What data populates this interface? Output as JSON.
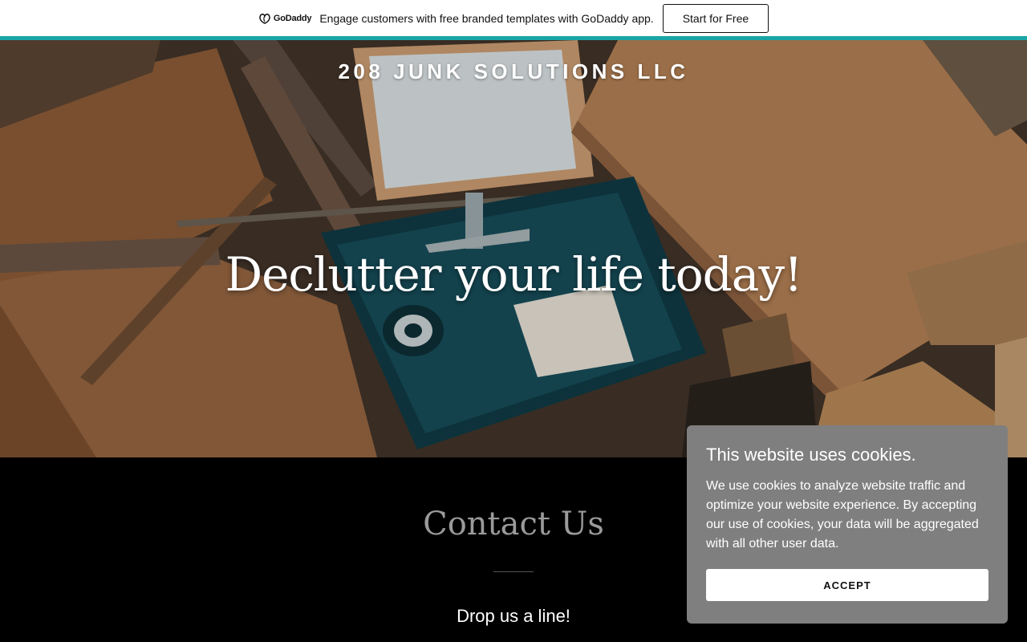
{
  "promo": {
    "logo_text": "GoDaddy",
    "logo_icon": "godaddy-logo-icon",
    "message": "Engage customers with free branded templates with GoDaddy app.",
    "cta_label": "Start for Free",
    "accent_color": "#1aa5a5"
  },
  "hero": {
    "site_title": "208 JUNK SOLUTIONS LLC",
    "headline": "Declutter your life today!"
  },
  "contact": {
    "title": "Contact Us",
    "subtitle": "Drop us a line!"
  },
  "cookie_banner": {
    "title": "This website uses cookies.",
    "body": "We use cookies to analyze website traffic and optimize your website experience. By accepting our use of cookies, your data will be aggregated with all other user data.",
    "accept_label": "ACCEPT"
  }
}
